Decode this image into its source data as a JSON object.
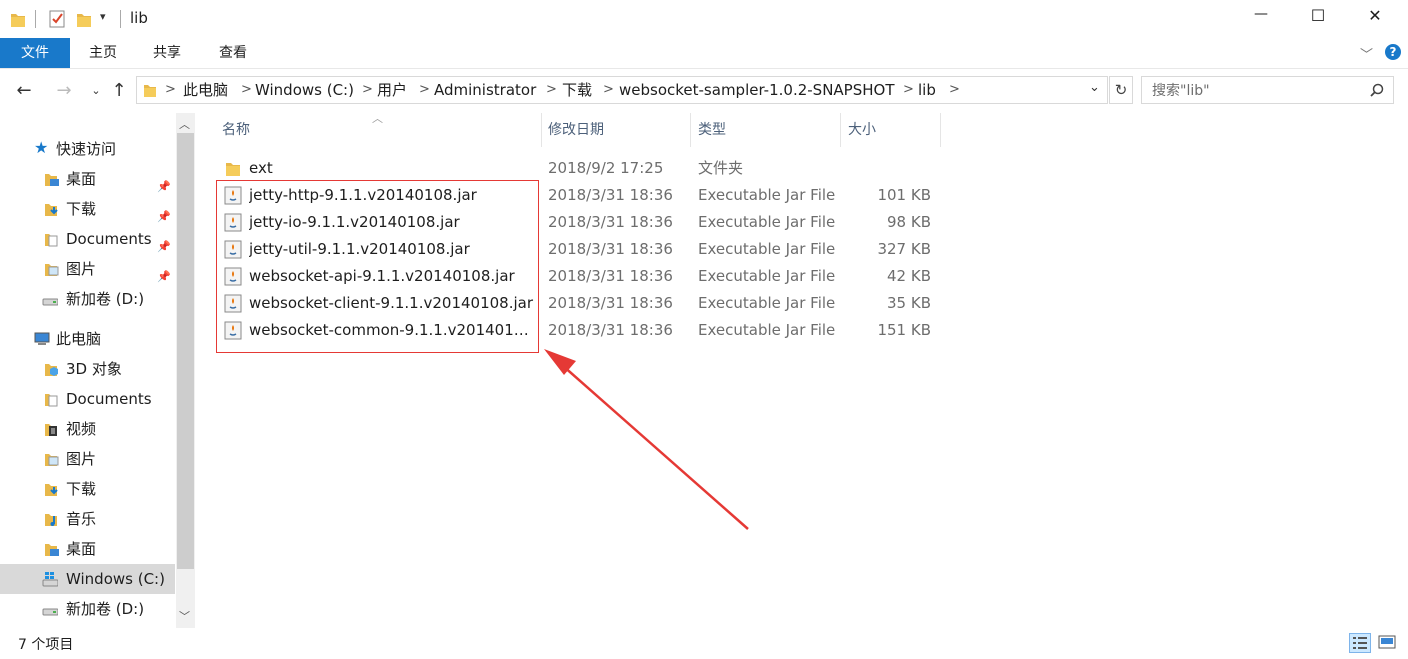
{
  "window": {
    "title": "lib",
    "controls": {
      "minimize": "—",
      "maximize": "☐",
      "close": "✕"
    }
  },
  "ribbon": {
    "tabs": [
      "文件",
      "主页",
      "共享",
      "查看"
    ]
  },
  "address": {
    "breadcrumbs": [
      "此电脑",
      "Windows (C:)",
      "用户",
      "Administrator",
      "下载",
      "websocket-sampler-1.0.2-SNAPSHOT",
      "lib"
    ],
    "search_placeholder": "搜索\"lib\""
  },
  "sidebar": {
    "quick_access_label": "快速访问",
    "quick_access": [
      {
        "label": "桌面",
        "icon": "desktop-folder-icon",
        "pinned": true
      },
      {
        "label": "下载",
        "icon": "downloads-folder-icon",
        "pinned": true
      },
      {
        "label": "Documents",
        "icon": "documents-folder-icon",
        "pinned": true
      },
      {
        "label": "图片",
        "icon": "pictures-folder-icon",
        "pinned": true
      },
      {
        "label": "新加卷 (D:)",
        "icon": "drive-icon",
        "pinned": false
      }
    ],
    "this_pc_label": "此电脑",
    "this_pc": [
      {
        "label": "3D 对象",
        "icon": "3d-objects-folder-icon"
      },
      {
        "label": "Documents",
        "icon": "documents-folder-icon"
      },
      {
        "label": "视频",
        "icon": "videos-folder-icon"
      },
      {
        "label": "图片",
        "icon": "pictures-folder-icon"
      },
      {
        "label": "下载",
        "icon": "downloads-folder-icon"
      },
      {
        "label": "音乐",
        "icon": "music-folder-icon"
      },
      {
        "label": "桌面",
        "icon": "desktop-folder-icon"
      },
      {
        "label": "Windows (C:)",
        "icon": "windows-drive-icon",
        "selected": true
      },
      {
        "label": "新加卷 (D:)",
        "icon": "drive-icon"
      }
    ]
  },
  "columns": {
    "name": "名称",
    "date": "修改日期",
    "type": "类型",
    "size": "大小"
  },
  "files": [
    {
      "name": "ext",
      "date": "2018/9/2 17:25",
      "type": "文件夹",
      "size": "",
      "icon": "folder-icon"
    },
    {
      "name": "jetty-http-9.1.1.v20140108.jar",
      "date": "2018/3/31 18:36",
      "type": "Executable Jar File",
      "size": "101 KB",
      "icon": "jar-file-icon"
    },
    {
      "name": "jetty-io-9.1.1.v20140108.jar",
      "date": "2018/3/31 18:36",
      "type": "Executable Jar File",
      "size": "98 KB",
      "icon": "jar-file-icon"
    },
    {
      "name": "jetty-util-9.1.1.v20140108.jar",
      "date": "2018/3/31 18:36",
      "type": "Executable Jar File",
      "size": "327 KB",
      "icon": "jar-file-icon"
    },
    {
      "name": "websocket-api-9.1.1.v20140108.jar",
      "date": "2018/3/31 18:36",
      "type": "Executable Jar File",
      "size": "42 KB",
      "icon": "jar-file-icon"
    },
    {
      "name": "websocket-client-9.1.1.v20140108.jar",
      "date": "2018/3/31 18:36",
      "type": "Executable Jar File",
      "size": "35 KB",
      "icon": "jar-file-icon"
    },
    {
      "name": "websocket-common-9.1.1.v2014010...",
      "date": "2018/3/31 18:36",
      "type": "Executable Jar File",
      "size": "151 KB",
      "icon": "jar-file-icon"
    }
  ],
  "status": {
    "item_count": "7 个项目"
  },
  "colors": {
    "accent": "#1979ca",
    "annotation": "#e53935",
    "selected_bg": "#cce8ff"
  }
}
